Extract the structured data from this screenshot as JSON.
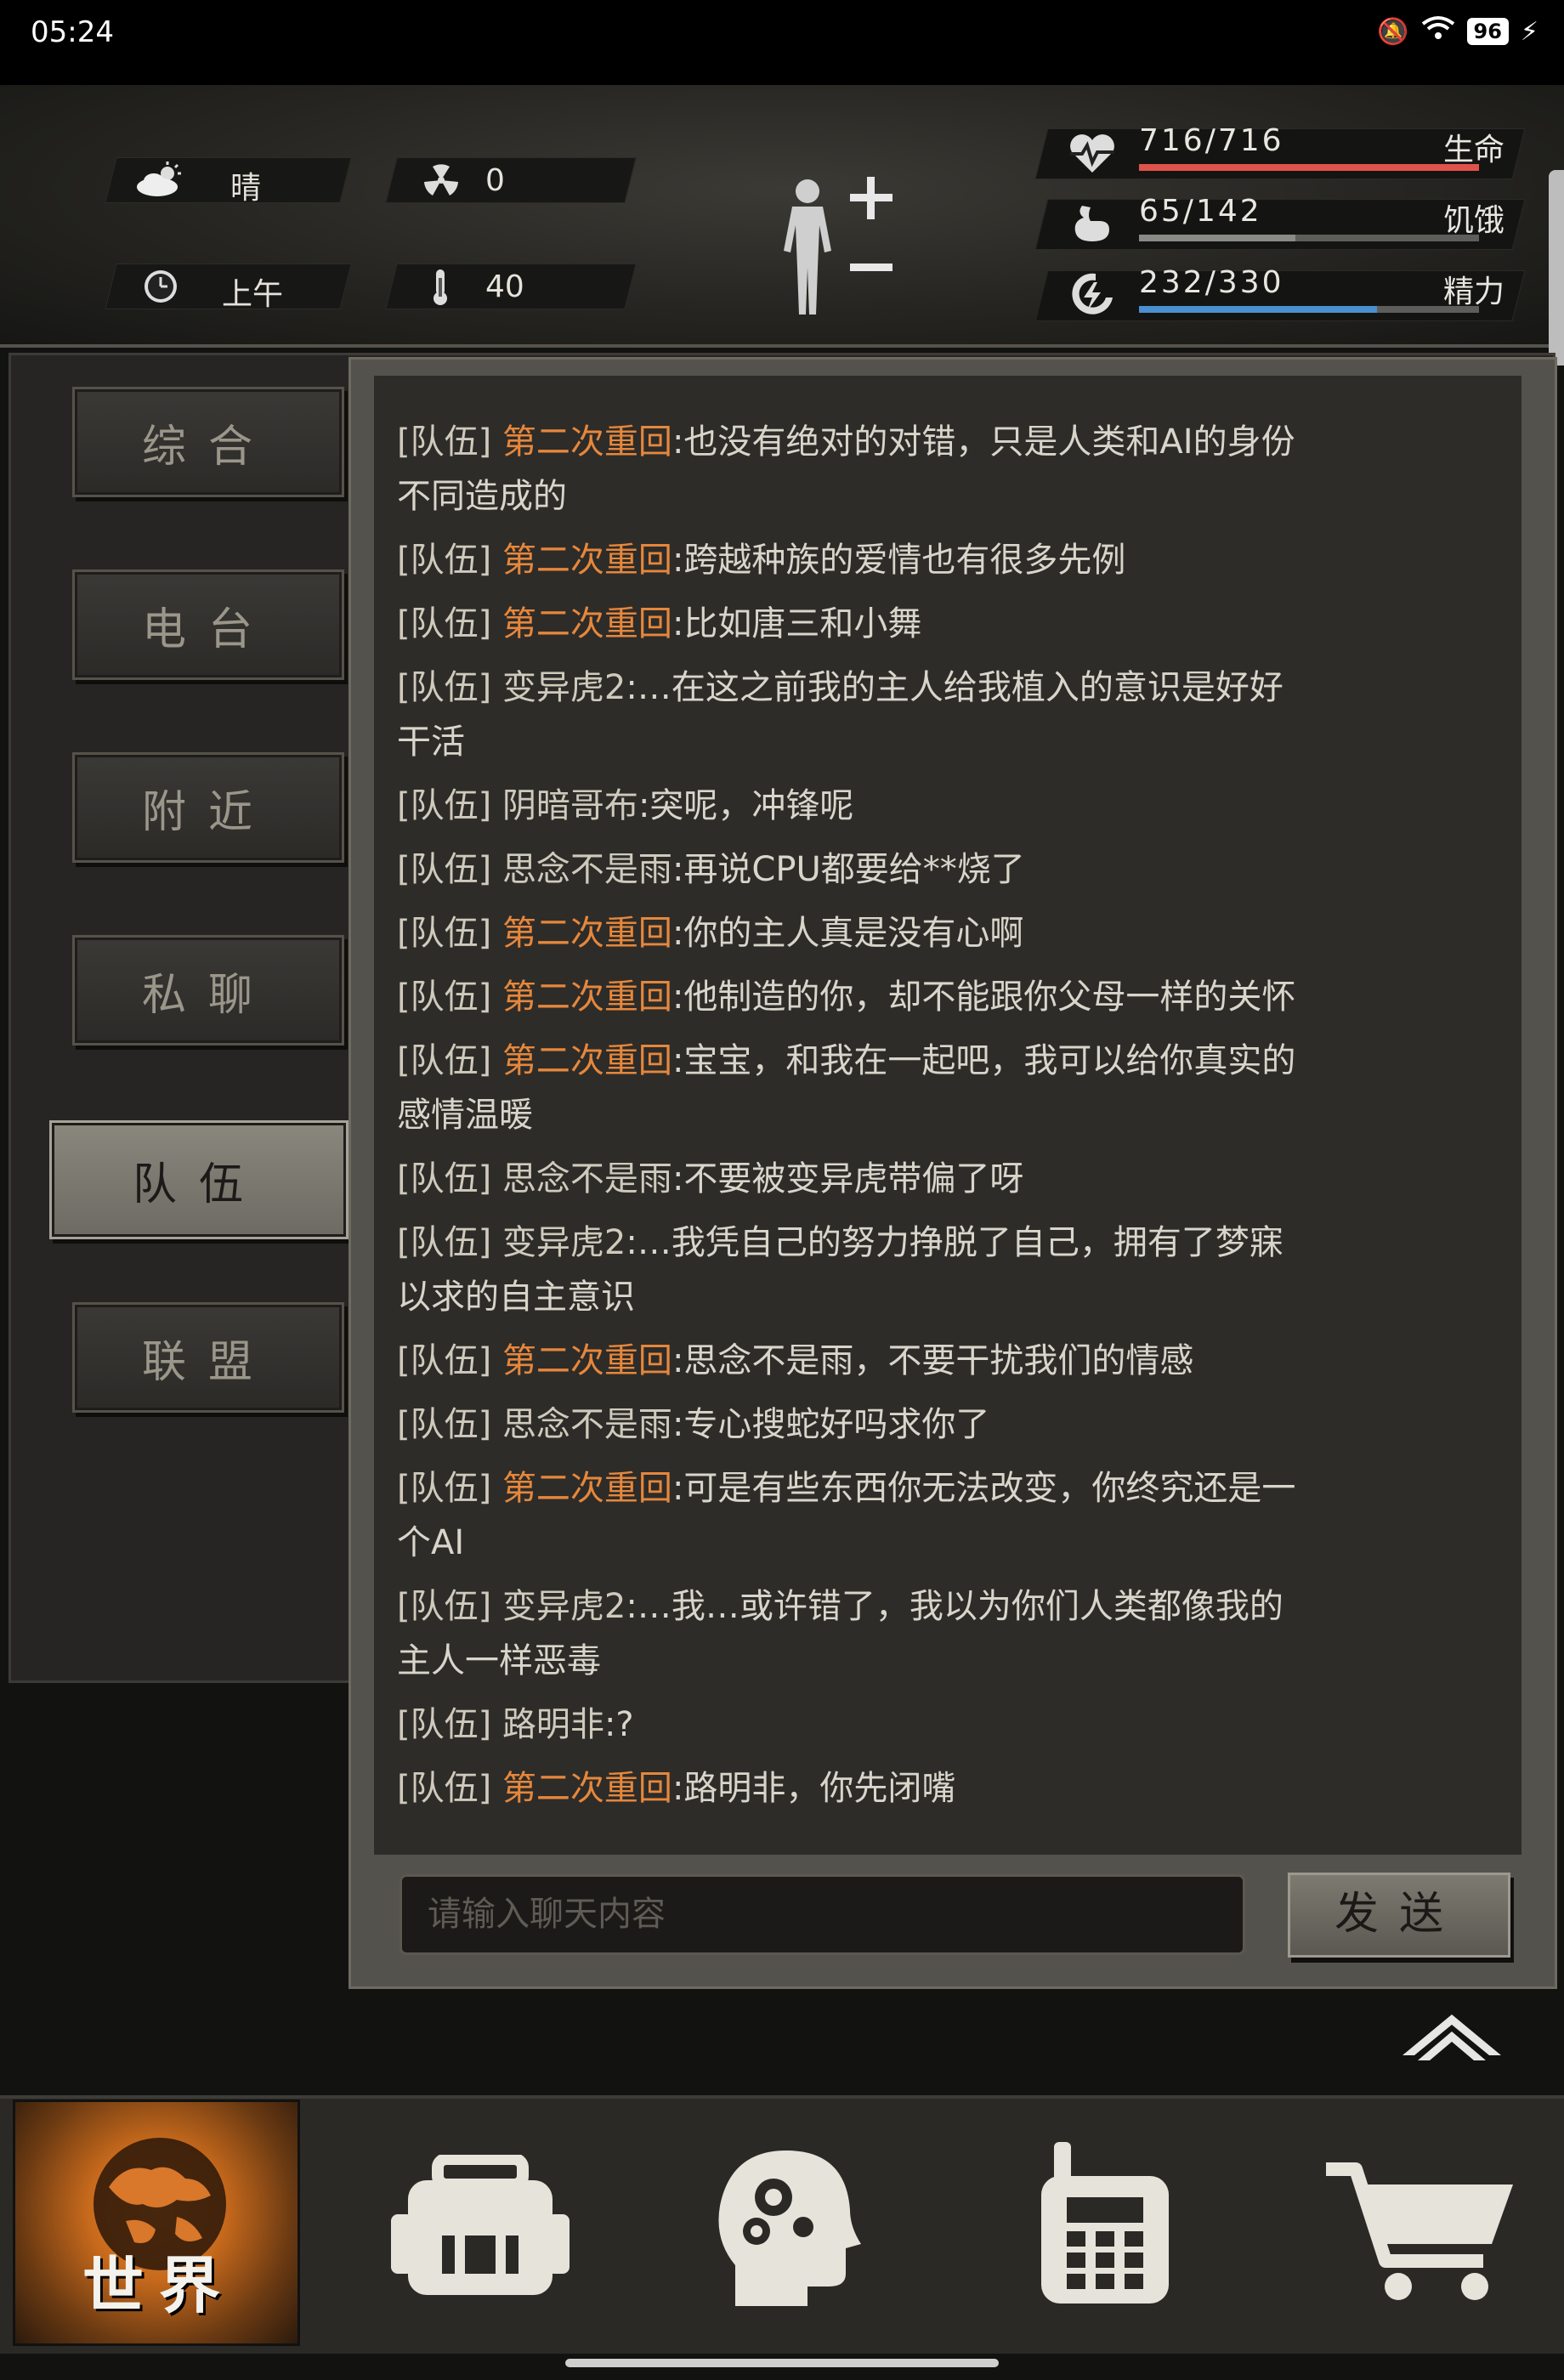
{
  "status_bar": {
    "time": "05:24",
    "battery": "96"
  },
  "hud": {
    "weather": "晴",
    "radiation": "0",
    "time_of_day": "上午",
    "temperature": "40",
    "stats": [
      {
        "value": "716/716",
        "label": "生命",
        "fill": 1.0,
        "color": "#e0534a"
      },
      {
        "value": "65/142",
        "label": "饥饿",
        "fill": 0.46,
        "color": "#8a8a86"
      },
      {
        "value": "232/330",
        "label": "精力",
        "fill": 0.7,
        "color": "#4a8fd0"
      }
    ]
  },
  "tabs": [
    "综合",
    "电台",
    "附近",
    "私聊",
    "队伍",
    "联盟"
  ],
  "active_tab": "队伍",
  "messages": [
    {
      "channel": "[队伍]",
      "name": "第二次重回",
      "name_color": "orange",
      "lines": [
        "也没有绝对的对错，只是人类和AI的身份",
        "不同造成的"
      ]
    },
    {
      "channel": "[队伍]",
      "name": "第二次重回",
      "name_color": "orange",
      "lines": [
        "跨越种族的爱情也有很多先例"
      ]
    },
    {
      "channel": "[队伍]",
      "name": "第二次重回",
      "name_color": "orange",
      "lines": [
        "比如唐三和小舞"
      ]
    },
    {
      "channel": "[队伍]",
      "name": "变异虎2",
      "name_color": "gray",
      "lines": [
        "…在这之前我的主人给我植入的意识是好好",
        "干活"
      ]
    },
    {
      "channel": "[队伍]",
      "name": "阴暗哥布",
      "name_color": "gray",
      "lines": [
        "突呢，冲锋呢"
      ]
    },
    {
      "channel": "[队伍]",
      "name": "思念不是雨",
      "name_color": "gray",
      "lines": [
        "再说CPU都要给**烧了"
      ]
    },
    {
      "channel": "[队伍]",
      "name": "第二次重回",
      "name_color": "orange",
      "lines": [
        "你的主人真是没有心啊"
      ]
    },
    {
      "channel": "[队伍]",
      "name": "第二次重回",
      "name_color": "orange",
      "lines": [
        "他制造的你，却不能跟你父母一样的关怀"
      ]
    },
    {
      "channel": "[队伍]",
      "name": "第二次重回",
      "name_color": "orange",
      "lines": [
        "宝宝，和我在一起吧，我可以给你真实的",
        "感情温暖"
      ]
    },
    {
      "channel": "[队伍]",
      "name": "思念不是雨",
      "name_color": "gray",
      "lines": [
        "不要被变异虎带偏了呀"
      ]
    },
    {
      "channel": "[队伍]",
      "name": "变异虎2",
      "name_color": "gray",
      "lines": [
        "…我凭自己的努力挣脱了自己，拥有了梦寐",
        "以求的自主意识"
      ]
    },
    {
      "channel": "[队伍]",
      "name": "第二次重回",
      "name_color": "orange",
      "lines": [
        "思念不是雨，不要干扰我们的情感"
      ]
    },
    {
      "channel": "[队伍]",
      "name": "思念不是雨",
      "name_color": "gray",
      "lines": [
        "专心搜蛇好吗求你了"
      ]
    },
    {
      "channel": "[队伍]",
      "name": "第二次重回",
      "name_color": "orange",
      "lines": [
        "可是有些东西你无法改变，你终究还是一",
        "个AI"
      ]
    },
    {
      "channel": "[队伍]",
      "name": "变异虎2",
      "name_color": "gray",
      "lines": [
        "…我…或许错了，我以为你们人类都像我的",
        "主人一样恶毒"
      ]
    },
    {
      "channel": "[队伍]",
      "name": "路明非",
      "name_color": "gray",
      "lines": [
        "?"
      ]
    },
    {
      "channel": "[队伍]",
      "name": "第二次重回",
      "name_color": "orange",
      "lines": [
        "路明非，你先闭嘴"
      ]
    }
  ],
  "input": {
    "placeholder": "请输入聊天内容",
    "value": ""
  },
  "send_label": "发送",
  "nav": {
    "world_label": "世界",
    "items": [
      "world-icon",
      "backpack-icon",
      "skills-brain-icon",
      "radio-icon",
      "cart-icon"
    ]
  }
}
